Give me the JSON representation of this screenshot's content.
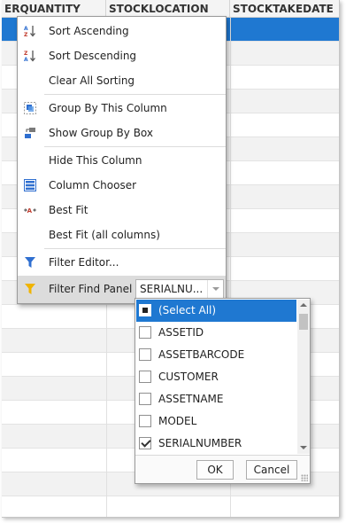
{
  "grid": {
    "columns": [
      "ERQUANTITY",
      "STOCKLOCATION",
      "STOCKTAKEDATE"
    ]
  },
  "menu": {
    "items": [
      {
        "label": "Sort Ascending",
        "icon": "sort-ascending-icon"
      },
      {
        "label": "Sort Descending",
        "icon": "sort-descending-icon"
      },
      {
        "label": "Clear All Sorting"
      },
      {
        "label": "Group By This Column",
        "icon": "group-by-icon"
      },
      {
        "label": "Show Group By Box",
        "icon": "group-box-icon"
      },
      {
        "label": "Hide This Column"
      },
      {
        "label": "Column Chooser",
        "icon": "column-chooser-icon"
      },
      {
        "label": "Best Fit",
        "icon": "best-fit-icon"
      },
      {
        "label": "Best Fit (all columns)"
      },
      {
        "label": "Filter Editor...",
        "icon": "filter-icon"
      },
      {
        "label": "Filter Find Panel",
        "icon": "filter-icon"
      }
    ],
    "find_panel_value": "SERIALNU..."
  },
  "filter_dropdown": {
    "options": [
      {
        "label": "(Select All)",
        "state": "indeterminate",
        "selected": true
      },
      {
        "label": "ASSETID",
        "state": "unchecked"
      },
      {
        "label": "ASSETBARCODE",
        "state": "unchecked"
      },
      {
        "label": "CUSTOMER",
        "state": "unchecked"
      },
      {
        "label": "ASSETNAME",
        "state": "unchecked"
      },
      {
        "label": "MODEL",
        "state": "unchecked"
      },
      {
        "label": "SERIALNUMBER",
        "state": "checked"
      }
    ],
    "ok_label": "OK",
    "cancel_label": "Cancel"
  },
  "colors": {
    "selection": "#1f78d1",
    "filter_icon_blue": "#2f6fd0",
    "filter_icon_gold": "#f0b400"
  }
}
